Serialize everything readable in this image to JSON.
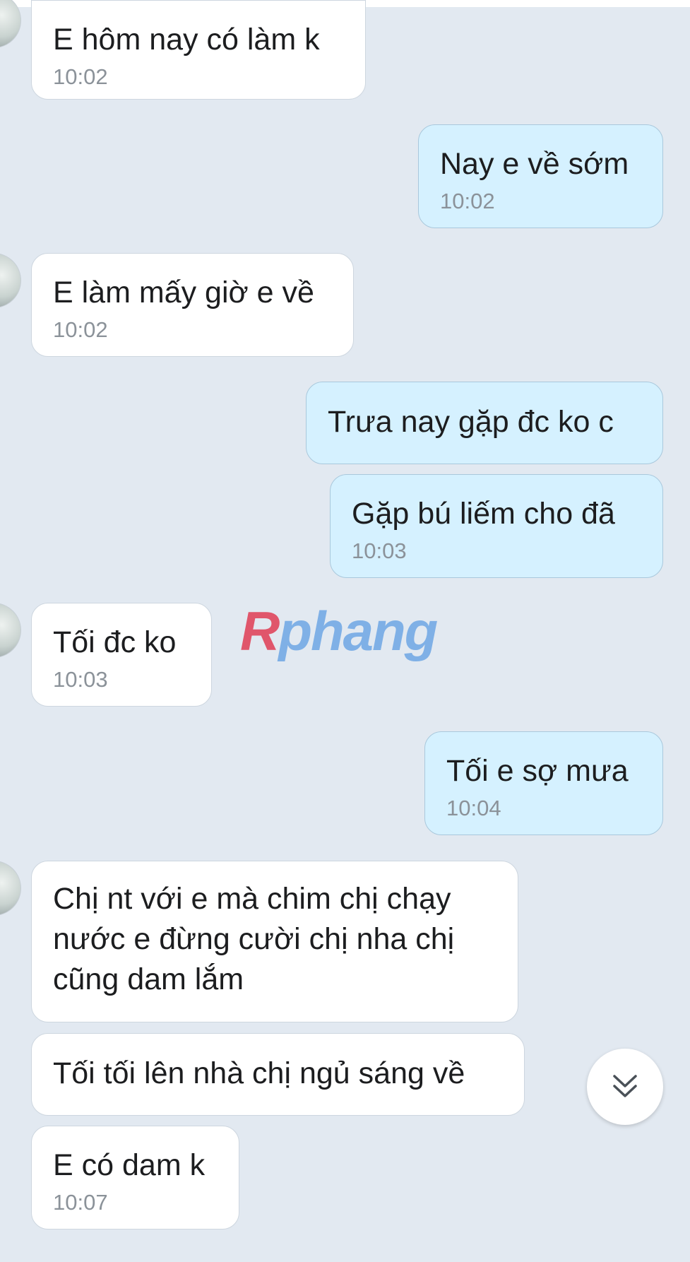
{
  "watermark": {
    "r": "R",
    "rest": "phang"
  },
  "messages": [
    {
      "text": "E hôm nay có làm k",
      "time": "10:02"
    },
    {
      "text": "Nay e về sớm",
      "time": "10:02"
    },
    {
      "text": "E làm mấy giờ e về",
      "time": "10:02"
    },
    {
      "text": "Trưa nay gặp đc ko c"
    },
    {
      "text": "Gặp bú liếm cho đã",
      "time": "10:03"
    },
    {
      "text": "Tối đc ko",
      "time": "10:03"
    },
    {
      "text": "Tối e sợ mưa",
      "time": "10:04"
    },
    {
      "text": "Chị nt với e mà chim chị chạy\nnước e đừng cười chị nha chị\ncũng dam lắm"
    },
    {
      "text": "Tối tối lên nhà chị ngủ sáng về"
    },
    {
      "text": "E có dam k",
      "time": "10:07"
    }
  ],
  "colors": {
    "background": "#e2e9f1",
    "incoming_bubble": "#ffffff",
    "outgoing_bubble": "#d5f1ff",
    "time_text": "#8b9299"
  },
  "icons": {
    "scroll_down": "double-chevron-down-icon"
  }
}
